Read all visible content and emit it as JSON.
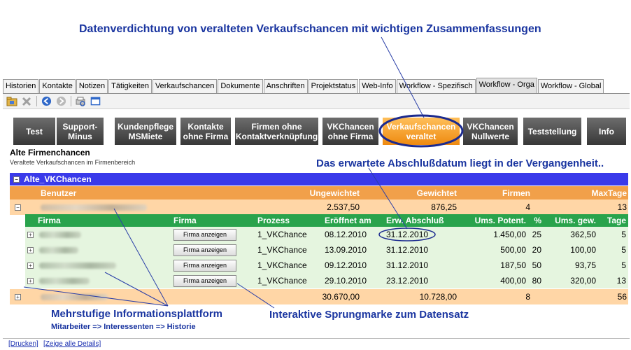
{
  "annotations": {
    "top": "Datenverdichtung von veralteten Verkaufschancen mit wichtigen Zusammenfassungen",
    "middle": "Das erwartete Abschlußdatum liegt in der Vergangenheit..",
    "bottom_left": "Mehrstufige Informationsplattform",
    "bottom_left_sub": "Mitarbeiter => Interessenten => Historie",
    "bottom_right": "Interaktive Sprungmarke zum Datensatz"
  },
  "tabs": [
    "Historien",
    "Kontakte",
    "Notizen",
    "Tätigkeiten",
    "Verkaufschancen",
    "Dokumente",
    "Anschriften",
    "Projektstatus",
    "Web-Info",
    "Workflow - Spezifisch",
    "Workflow - Orga",
    "Workflow - Global"
  ],
  "active_tab": "Workflow - Orga",
  "toolbar_icons": [
    "open-folder-icon",
    "delete-icon",
    "back-icon",
    "forward-icon",
    "print-preview-icon",
    "window-icon"
  ],
  "buttons": [
    {
      "name": "test-button",
      "label": "Test"
    },
    {
      "name": "support-minus-button",
      "label": "Support-\nMinus"
    },
    {
      "name": "kundenpflege-button",
      "label": "Kundenpflege\nMSMiete"
    },
    {
      "name": "kontakte-ohne-firma-button",
      "label": "Kontakte\nohne Firma"
    },
    {
      "name": "firmen-ohne-kontakt-button",
      "label": "Firmen ohne\nKontaktverknüpfung"
    },
    {
      "name": "vkchancen-ohne-firma-button",
      "label": "VKChancen\nohne Firma"
    },
    {
      "name": "verkaufschancen-veraltet-button",
      "label": "Verkaufschancen\nveraltet"
    },
    {
      "name": "vkchancen-nullwerte-button",
      "label": "VKChancen\nNullwerte"
    },
    {
      "name": "teststellung-button",
      "label": "Teststellung"
    },
    {
      "name": "info-button",
      "label": "Info"
    }
  ],
  "page": {
    "title": "Alte Firmenchancen",
    "subtitle": "Veraltete Verkaufschancen im Firmenbereich"
  },
  "section": {
    "collapse": "−",
    "title": "Alte_VKChancen"
  },
  "outer_headers": {
    "benutzer": "Benutzer",
    "ungewichtet": "Ungewichtet",
    "gewichtet": "Gewichtet",
    "firmen": "Firmen",
    "maxtage": "MaxTage"
  },
  "outer_rows": [
    {
      "toggle": "−",
      "ungewichtet": "2.537,50",
      "gewichtet": "876,25",
      "firmen": "4",
      "maxtage": "13"
    },
    {
      "toggle": "+",
      "ungewichtet": "30.670,00",
      "gewichtet": "10.728,00",
      "firmen": "8",
      "maxtage": "56"
    }
  ],
  "inner_headers": {
    "firma": "Firma",
    "firma2": "Firma",
    "prozess": "Prozess",
    "eroeffnet": "Eröffnet am",
    "abschluss": "Erw. Abschluß",
    "potent": "Ums. Potent.",
    "pct": "%",
    "gew": "Ums. gew.",
    "tage": "Tage"
  },
  "inner_rows": [
    {
      "toggle": "+",
      "button": "Firma anzeigen",
      "prozess": "1_VKChance",
      "eroeffnet": "08.12.2010",
      "abschluss": "31.12.2010",
      "potent": "1.450,00",
      "pct": "25",
      "gew": "362,50",
      "tage": "5"
    },
    {
      "toggle": "+",
      "button": "Firma anzeigen",
      "prozess": "1_VKChance",
      "eroeffnet": "13.09.2010",
      "abschluss": "31.12.2010",
      "potent": "500,00",
      "pct": "20",
      "gew": "100,00",
      "tage": "5"
    },
    {
      "toggle": "+",
      "button": "Firma anzeigen",
      "prozess": "1_VKChance",
      "eroeffnet": "09.12.2010",
      "abschluss": "31.12.2010",
      "potent": "187,50",
      "pct": "50",
      "gew": "93,75",
      "tage": "5"
    },
    {
      "toggle": "+",
      "button": "Firma anzeigen",
      "prozess": "1_VKChance",
      "eroeffnet": "29.10.2010",
      "abschluss": "23.12.2010",
      "potent": "400,00",
      "pct": "80",
      "gew": "320,00",
      "tage": "13"
    }
  ],
  "footer": {
    "print": "[Drucken]",
    "details": "[Zeige alle Details]"
  },
  "colors": {
    "callout": "#1a35a0",
    "section": "#3a3aea",
    "outer_header": "#f1a04a",
    "outer_row": "#ffd6a6",
    "inner_header": "#29a34c",
    "inner_row": "#e5f5df",
    "highlight_button": "#f29a22"
  }
}
